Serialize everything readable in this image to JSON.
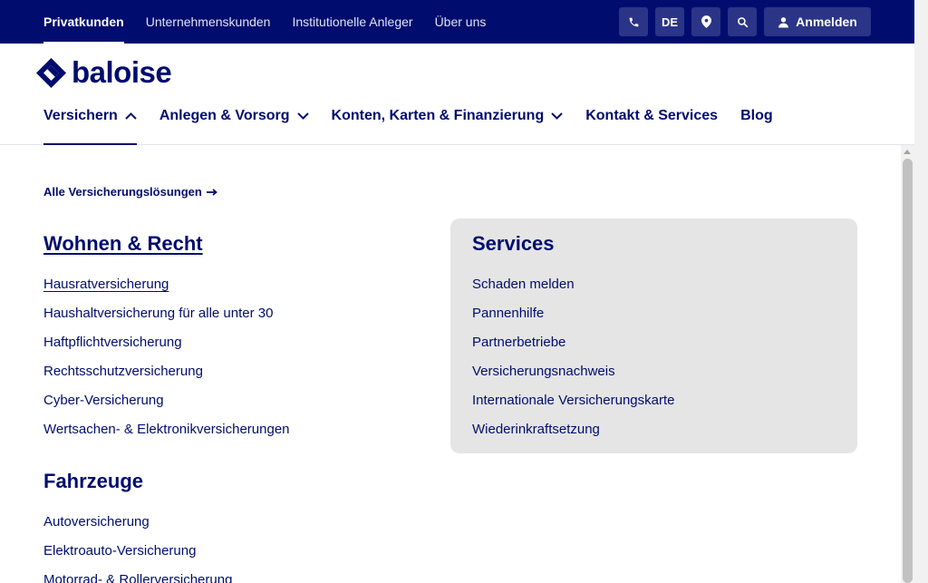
{
  "topnav": [
    "Privatkunden",
    "Unternehmenskunden",
    "Institutionelle Anleger",
    "Über uns"
  ],
  "topicons": {
    "phone": "phone-icon",
    "language": "DE",
    "location": "location-pin-icon",
    "search": "search-icon",
    "login": "Anmelden",
    "login_icon": "user-icon"
  },
  "logo": {
    "text": "baloise"
  },
  "mainnav": [
    {
      "label": "Versichern",
      "chevron": "chevron-up-icon"
    },
    {
      "label": "Anlegen & Vorsorg",
      "chevron": "chevron-down-icon"
    },
    {
      "label": "Konten, Karten & Finanzierung",
      "chevron": "chevron-down-icon"
    },
    {
      "label": "Kontakt & Services"
    },
    {
      "label": "Blog"
    }
  ],
  "content": {
    "all_link": "Alle Versicherungslösungen",
    "sections": [
      {
        "title": "Wohnen & Recht",
        "links": [
          "Hausratversicherung",
          "Haushaltversicherung für alle unter 30",
          "Haftpflichtversicherung",
          "Rechtsschutzversicherung",
          "Cyber-Versicherung",
          "Wertsachen- & Elektronikversicherungen"
        ]
      },
      {
        "title": "Fahrzeuge",
        "links": [
          "Autoversicherung",
          "Elektroauto-Versicherung",
          "Motorrad- & Rollerversicherung"
        ]
      }
    ],
    "services": {
      "title": "Services",
      "links": [
        "Schaden melden",
        "Pannenhilfe",
        "Partnerbetriebe",
        "Versicherungsnachweis",
        "Internationale Versicherungskarte",
        "Wiederinkraftsetzung"
      ]
    }
  },
  "colors": {
    "brand": "#000d6e",
    "topbar": "#000d6e",
    "services_bg": "#e5e5e5"
  }
}
